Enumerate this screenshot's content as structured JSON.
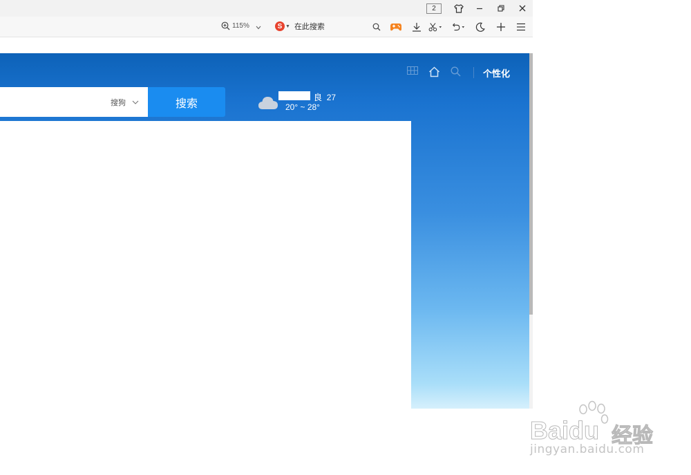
{
  "titlebar": {
    "tab_count": "2",
    "icons": [
      "skin-icon",
      "minimize-icon",
      "restore-icon",
      "close-icon"
    ]
  },
  "toolbar": {
    "zoom_level": "115%",
    "search_engine_placeholder": "在此搜索",
    "icons": [
      "game-icon",
      "download-icon",
      "screenshot-icon",
      "undo-icon",
      "night-mode-icon",
      "add-icon",
      "menu-icon"
    ]
  },
  "header": {
    "personalize_label": "个性化",
    "icons": [
      "apps-icon",
      "home-icon",
      "search-icon"
    ]
  },
  "search": {
    "engine": "搜狗",
    "button_label": "搜索"
  },
  "weather": {
    "air_quality": "良",
    "aqi_value": "27",
    "temperature_range": "20° ~ 28°",
    "icon": "cloud-icon"
  },
  "watermark": {
    "brand": "Baidu",
    "brand_cn": "经验",
    "url": "jingyan.baidu.com"
  },
  "colors": {
    "header_blue": "#0d62b8",
    "search_button": "#1a8cf0",
    "sky_light": "#a9def9"
  }
}
